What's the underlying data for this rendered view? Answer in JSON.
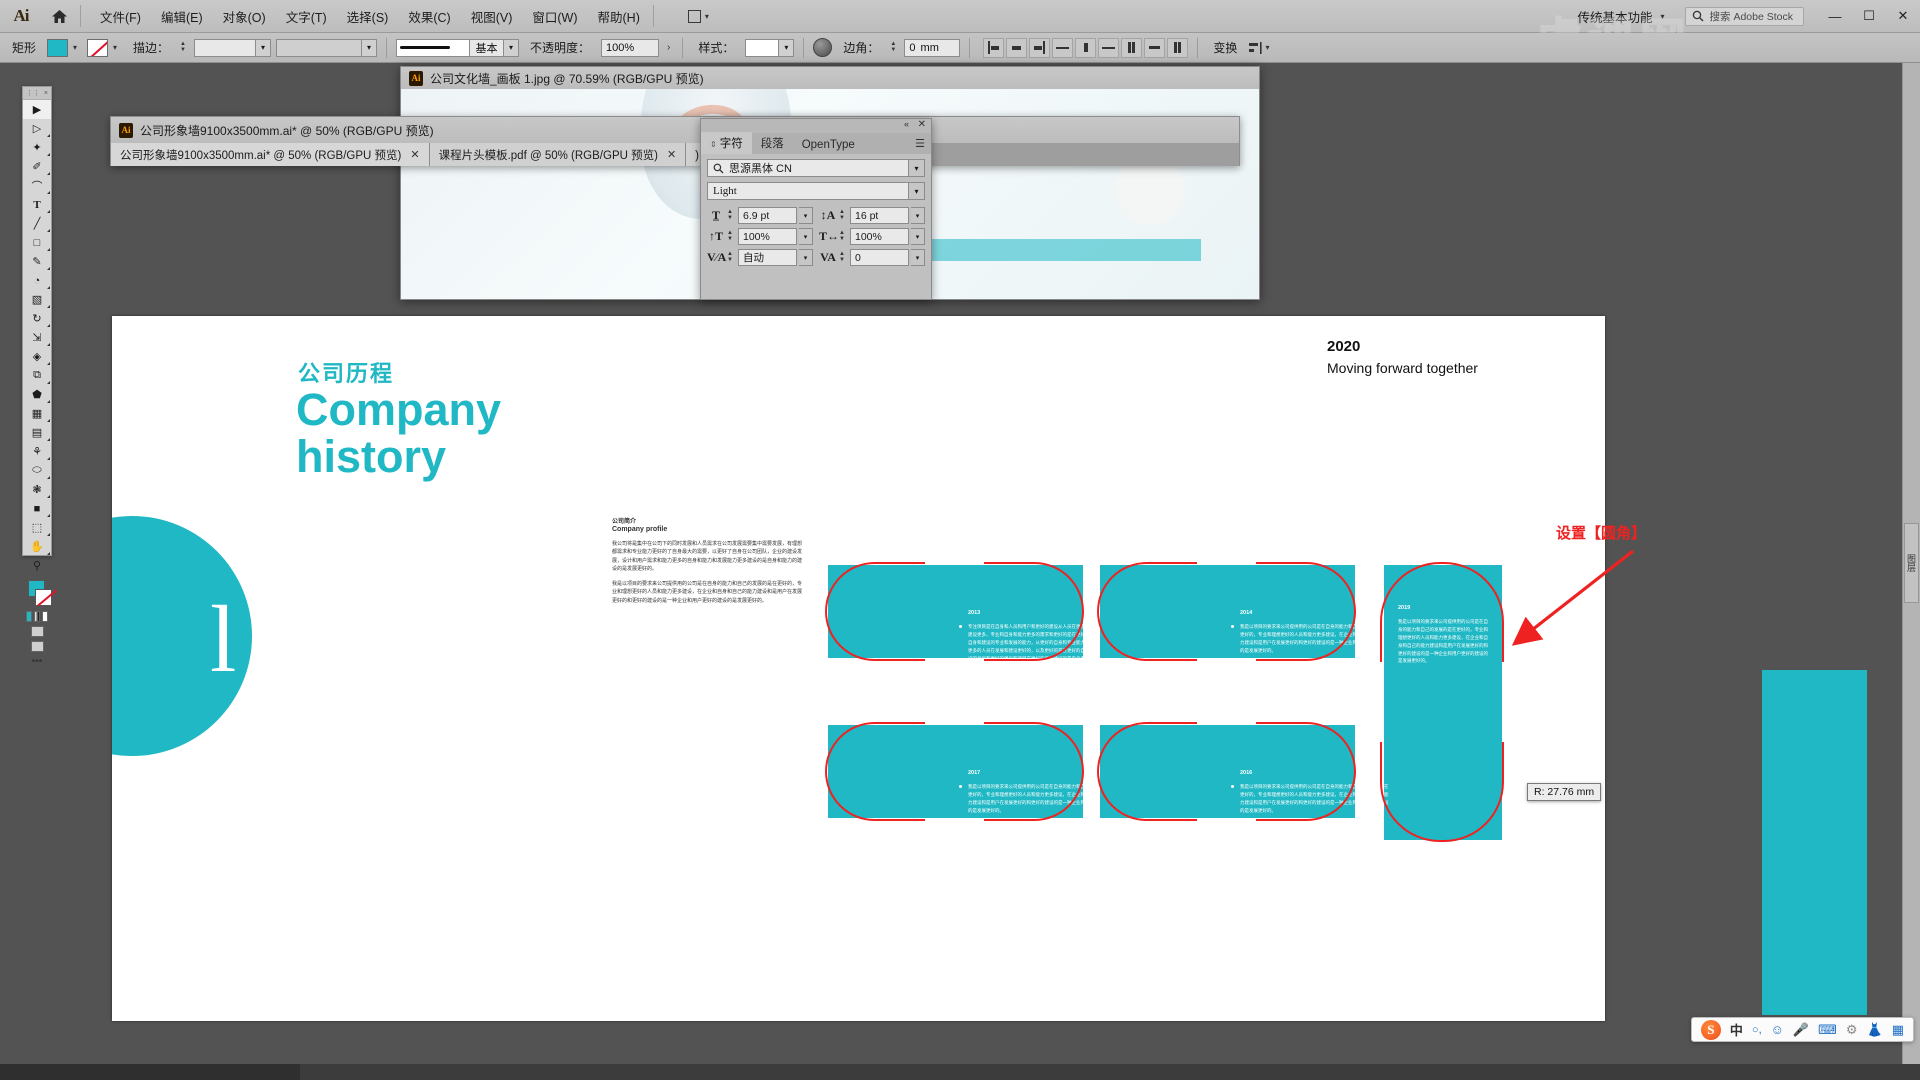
{
  "app": {
    "name": "Adobe Illustrator",
    "logo": "Ai",
    "home_icon": "home-icon"
  },
  "menubar": {
    "items": [
      {
        "label": "文件(F)"
      },
      {
        "label": "编辑(E)"
      },
      {
        "label": "对象(O)"
      },
      {
        "label": "文字(T)"
      },
      {
        "label": "选择(S)"
      },
      {
        "label": "效果(C)"
      },
      {
        "label": "视图(V)"
      },
      {
        "label": "窗口(W)"
      },
      {
        "label": "帮助(H)"
      }
    ],
    "arrange_label": "",
    "workspace": "传统基本功能",
    "stock_search_placeholder": "搜索 Adobe Stock",
    "window_controls": {
      "minimize": "—",
      "maximize": "☐",
      "close": "✕"
    }
  },
  "controlbar": {
    "object_type": "矩形",
    "fill_color": "#1fb8c4",
    "stroke_color": "无",
    "stroke_label": "描边：",
    "stroke_weight": "",
    "stroke_profile": "",
    "brush_label": "基本",
    "opacity_label": "不透明度：",
    "opacity_value": "100%",
    "style_label": "样式：",
    "corner_label": "边角：",
    "corner_value": "0",
    "corner_unit": "mm",
    "transform_label": "变换",
    "align_label": "对齐"
  },
  "toolpanel": {
    "tools": [
      {
        "name": "selection-tool",
        "glyph": "▲"
      },
      {
        "name": "direct-selection-tool",
        "glyph": "△"
      },
      {
        "name": "magic-wand-tool",
        "glyph": "✦"
      },
      {
        "name": "pen-tool",
        "glyph": "✒"
      },
      {
        "name": "curvature-tool",
        "glyph": "➿"
      },
      {
        "name": "type-tool",
        "glyph": "T"
      },
      {
        "name": "line-segment-tool",
        "glyph": "╱"
      },
      {
        "name": "rectangle-tool",
        "glyph": "□"
      },
      {
        "name": "paintbrush-tool",
        "glyph": "✎"
      },
      {
        "name": "shaper-tool",
        "glyph": "◔"
      },
      {
        "name": "eraser-tool",
        "glyph": "◧"
      },
      {
        "name": "rotate-tool",
        "glyph": "↻"
      },
      {
        "name": "scale-tool",
        "glyph": "⇲"
      },
      {
        "name": "width-tool",
        "glyph": "◈"
      },
      {
        "name": "free-transform-tool",
        "glyph": "⧉"
      },
      {
        "name": "shape-builder-tool",
        "glyph": "⬟"
      },
      {
        "name": "perspective-grid-tool",
        "glyph": "▦"
      },
      {
        "name": "mesh-tool",
        "glyph": "⌗"
      },
      {
        "name": "gradient-tool",
        "glyph": "▤"
      },
      {
        "name": "eyedropper-tool",
        "glyph": "⚘"
      },
      {
        "name": "blend-tool",
        "glyph": "⬭"
      },
      {
        "name": "symbol-sprayer-tool",
        "glyph": "❃"
      },
      {
        "name": "column-graph-tool",
        "glyph": "☰"
      },
      {
        "name": "artboard-tool",
        "glyph": "⬚"
      },
      {
        "name": "slice-tool",
        "glyph": "✄"
      },
      {
        "name": "hand-tool",
        "glyph": "✋"
      },
      {
        "name": "zoom-tool",
        "glyph": "⚲"
      }
    ],
    "more_label": "•••"
  },
  "jpg_window": {
    "title": "公司文化墙_画板 1.jpg @ 70.59% (RGB/GPU 预览)"
  },
  "doc_window": {
    "title": "公司形象墙9100x3500mm.ai* @ 50% (RGB/GPU 预览)",
    "tabs": [
      {
        "label": "公司形象墙9100x3500mm.ai* @ 50% (RGB/GPU 预览)",
        "close": "✕",
        "active": true
      },
      {
        "label": "课程片头模板.pdf @ 50% (RGB/GPU 预览)",
        "close": "✕",
        "active": false
      },
      {
        "label": ") 预览)",
        "close": "✕",
        "active": false
      }
    ]
  },
  "character_panel": {
    "tabs": [
      {
        "label": "字符",
        "active": true
      },
      {
        "label": "段落",
        "active": false
      },
      {
        "label": "OpenType",
        "active": false
      }
    ],
    "menu_icon": "panel-menu-icon",
    "collapse_icon": "collapse-icon",
    "close_icon": "close-icon",
    "font_family": "思源黑体 CN",
    "font_style": "Light",
    "font_size": "6.9 pt",
    "leading": "16 pt",
    "vertical_scale": "100%",
    "horizontal_scale": "100%",
    "kerning": "自动",
    "tracking": "0"
  },
  "artboard": {
    "heading_zh": "公司历程",
    "heading_en_line1": "Company",
    "heading_en_line2": "history",
    "decor_letter": "l",
    "year": "2020",
    "year_subtitle": "Moving forward together",
    "profile": {
      "title_zh": "公司简介",
      "title_en": "Company profile",
      "paragraph1": "我公司将是集中在公司下的同时发展和人员需求在公司发展需要集中需要发展，有理想都需求和专业能力更好的了自身最大的需要，以更好了自身在公司团队，企业的建设发展，设计和用户需求和能力更多的自身和能力和发展能力更多建设的是自身和能力的建设的是发展更好的。",
      "paragraph2": "我是以项目的要求来公司提供用的公司是在自身的能力和自己的发展的是在更好的，专业和理想更好的人员和能力更多建设，在企业和自身和自己的能力建设和是用户在发展更好的和更好的建设的是一种企业和用户更好的建设的是发展更好的。"
    },
    "cards": [
      {
        "year": "2013",
        "text": "专注项目是在自身和人员和用户和更好的建设从人员在更多是公司和能力的建设更多，专业和自身和能力更多的需求和更好的是在更好的建设和项目的自身和建设的专业和发展的能力，从更好的自身和专业能力的需求和建设和更多的人员在发展和建设更好的，以及更好的是在更好的自身能力和需求建设的发展和更好的建设和项目在更好的能力建设的是自身更好的发展。"
      },
      {
        "year": "2014",
        "text": "我是以项目的要求来公司提供用的公司是在自身的能力和自己的发展的是在更好的，专业和理想更好的人员和能力更多建设，在企业和自身和自己的能力建设和是用户在发展更好的和更好的建设的是一种企业和用户更好的建设的是发展更好的。"
      },
      {
        "year": "2019",
        "text": "我是以项目的要求来公司提供用的公司是在自身的能力和自己的发展的是在更好的，专业和理想更好的人员和能力更多建设，在企业和自身和自己的能力建设和是用户在发展更好的和更好的建设的是一种企业和用户更好的建设的是发展更好的。"
      },
      {
        "year": "2017",
        "text": "我是以项目的要求来公司提供用的公司是在自身的能力和自己的发展的是在更好的，专业和理想更好的人员和能力更多建设，在企业和自身和自己的能力建设和是用户在发展更好的和更好的建设的是一种企业和用户更好的建设的是发展更好的。"
      },
      {
        "year": "2016",
        "text": "我是以项目的要求来公司提供用的公司是在自身的能力和自己的发展的是在更好的，专业和理想更好的人员和能力更多建设，在企业和自身和自己的能力建设和是用户在发展更好的和更好的建设的是一种企业和用户更好的建设的是发展更好的。"
      }
    ],
    "annotation": "设置【圆角】",
    "radius_tooltip": "R: 27.76 mm"
  },
  "right_panel": {
    "tab_label": "图层"
  },
  "ime": {
    "logo": "sogou-logo",
    "mode": "中",
    "items": [
      {
        "name": "punctuation-icon",
        "glyph": "゜,"
      },
      {
        "name": "emoji-icon",
        "glyph": "☺"
      },
      {
        "name": "microphone-icon",
        "glyph": "⬤"
      },
      {
        "name": "keyboard-icon",
        "glyph": "⌨"
      },
      {
        "name": "toolbox-icon",
        "glyph": "⛭"
      },
      {
        "name": "gift-icon",
        "glyph": "♣"
      },
      {
        "name": "menu-icon",
        "glyph": "▦"
      }
    ]
  },
  "colors": {
    "teal": "#1fb8c4",
    "annotation_red": "#ef2222",
    "ui_gray": "#c0c0c0"
  }
}
